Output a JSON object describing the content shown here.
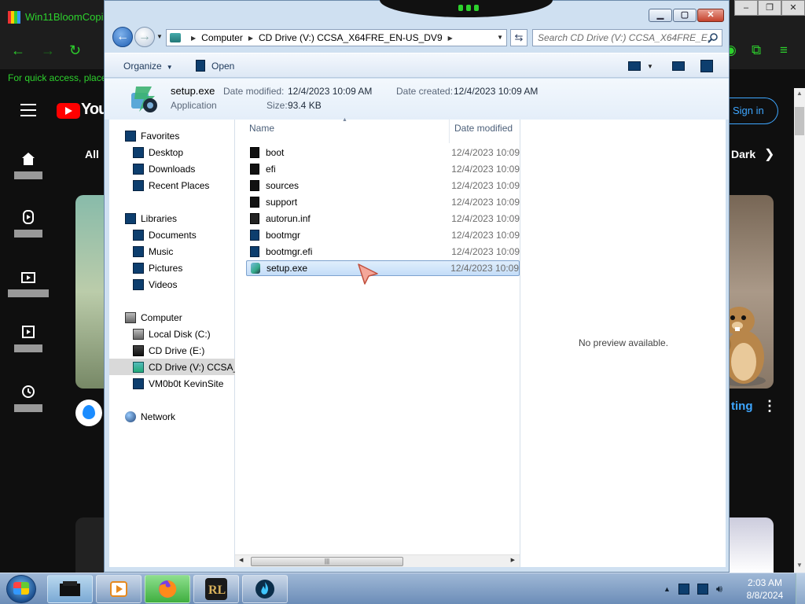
{
  "background": {
    "app_title": "Win11BloomCopilo",
    "quick_access_text": "For quick access, place",
    "youtube": {
      "logo_text": "You",
      "chip_all": "All",
      "chip_dark": "Dark",
      "sign_in": "Sign in",
      "channel_text": "ting",
      "nav": [
        "Home",
        "Shorts",
        "Subscriptions",
        "You",
        "History"
      ]
    }
  },
  "explorer": {
    "address": {
      "crumbs": [
        "Computer",
        "CD Drive (V:) CCSA_X64FRE_EN-US_DV9"
      ]
    },
    "search": {
      "placeholder": "Search CD Drive (V:) CCSA_X64FRE_E..."
    },
    "toolbar": {
      "organize_label": "Organize",
      "open_label": "Open"
    },
    "details": {
      "name": "setup.exe",
      "type": "Application",
      "date_modified_label": "Date modified:",
      "date_modified": "12/4/2023 10:09 AM",
      "date_created_label": "Date created:",
      "date_created": "12/4/2023 10:09 AM",
      "size_label": "Size:",
      "size": "93.4 KB"
    },
    "nav_pane": {
      "favorites": {
        "label": "Favorites",
        "items": [
          "Desktop",
          "Downloads",
          "Recent Places"
        ]
      },
      "libraries": {
        "label": "Libraries",
        "items": [
          "Documents",
          "Music",
          "Pictures",
          "Videos"
        ]
      },
      "computer": {
        "label": "Computer",
        "items": [
          "Local Disk (C:)",
          "CD Drive (E:)",
          "CD Drive (V:) CCSA_",
          "VM0b0t KevinSite"
        ]
      },
      "network": {
        "label": "Network"
      }
    },
    "columns": {
      "name": "Name",
      "date_modified": "Date modified"
    },
    "files": [
      {
        "name": "boot",
        "date": "12/4/2023 10:09",
        "kind": "folder"
      },
      {
        "name": "efi",
        "date": "12/4/2023 10:09",
        "kind": "folder"
      },
      {
        "name": "sources",
        "date": "12/4/2023 10:09",
        "kind": "folder"
      },
      {
        "name": "support",
        "date": "12/4/2023 10:09",
        "kind": "folder"
      },
      {
        "name": "autorun.inf",
        "date": "12/4/2023 10:09",
        "kind": "inf"
      },
      {
        "name": "bootmgr",
        "date": "12/4/2023 10:09",
        "kind": "file"
      },
      {
        "name": "bootmgr.efi",
        "date": "12/4/2023 10:09",
        "kind": "file"
      },
      {
        "name": "setup.exe",
        "date": "12/4/2023 10:09",
        "kind": "exe",
        "selected": true
      }
    ],
    "preview_text": "No preview available."
  },
  "taskbar": {
    "clock_time": "2:03 AM",
    "clock_date": "8/8/2024"
  },
  "colors": {
    "selection": "#c4ddf8",
    "window_frame": "#cfe0f1",
    "accent_green": "#2dd12d"
  }
}
